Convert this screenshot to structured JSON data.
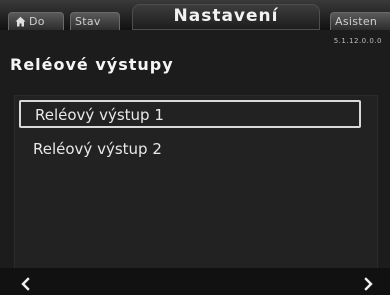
{
  "tabs": {
    "home": "Do",
    "status": "Stav",
    "active": "Nastavení",
    "assist": "Asisten"
  },
  "version": "5.1.12.0.0.0",
  "page_title": "Reléové výstupy",
  "items": [
    {
      "label": "Reléový výstup 1",
      "selected": true
    },
    {
      "label": "Reléový výstup 2",
      "selected": false
    }
  ],
  "icons": {
    "home": "home-icon",
    "left": "chevron-left-icon",
    "right": "chevron-right-icon"
  }
}
